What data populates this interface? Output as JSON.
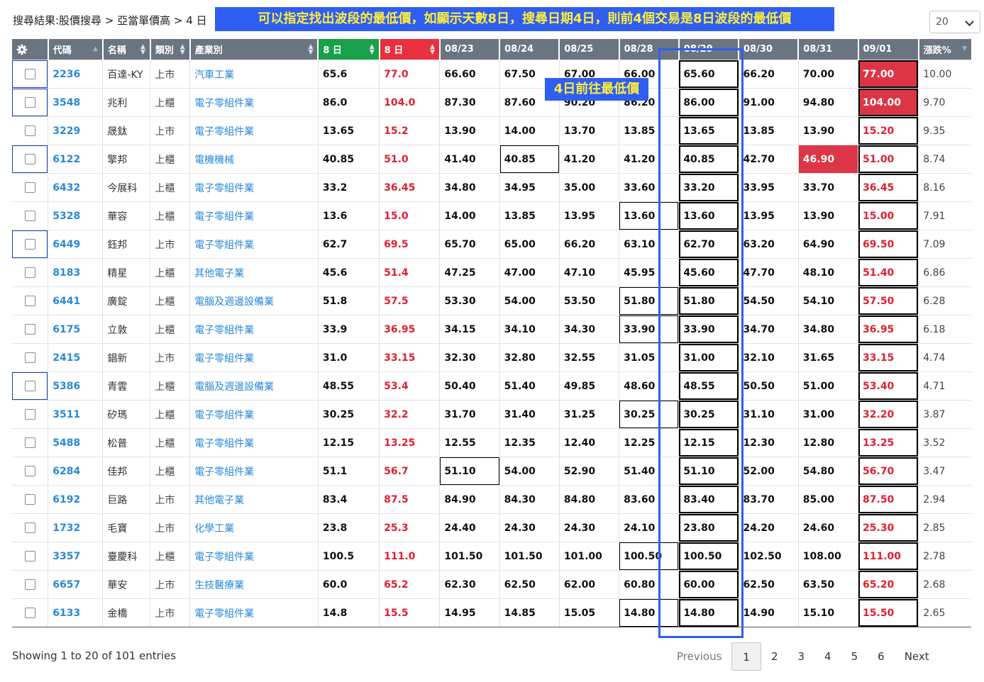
{
  "breadcrumb": "搜尋結果:股價搜尋 > 亞當單價高 > 4 日",
  "banner": "可以指定找出波段的最低價，如顯示天數8日，搜尋日期4日，則前4個交易是8日波段的最低價",
  "annotation_tag": "4日前往最低價",
  "page_size": "20",
  "headers": [
    "",
    "代碼",
    "名稱",
    "類別",
    "產業別",
    "8 日",
    "8 日",
    "08/23",
    "08/24",
    "08/25",
    "08/28",
    "08/29",
    "08/30",
    "08/31",
    "09/01",
    "漲跌%"
  ],
  "rows": [
    [
      "2236",
      "百達-KY",
      "上市",
      "汽車工業",
      "65.6",
      "77.0",
      "66.60",
      "67.50",
      "67.00",
      "66.00",
      "65.60",
      "66.20",
      "70.00",
      "77.00",
      "10.00"
    ],
    [
      "3548",
      "兆利",
      "上櫃",
      "電子零組件業",
      "86.0",
      "104.0",
      "87.30",
      "87.60",
      "90.20",
      "86.20",
      "86.00",
      "91.00",
      "94.80",
      "104.00",
      "9.70"
    ],
    [
      "3229",
      "晟鈦",
      "上市",
      "電子零組件業",
      "13.65",
      "15.2",
      "13.90",
      "14.00",
      "13.70",
      "13.85",
      "13.65",
      "13.85",
      "13.90",
      "15.20",
      "9.35"
    ],
    [
      "6122",
      "擎邦",
      "上櫃",
      "電機機械",
      "40.85",
      "51.0",
      "41.40",
      "40.85",
      "41.20",
      "41.20",
      "40.85",
      "42.70",
      "46.90",
      "51.00",
      "8.74"
    ],
    [
      "6432",
      "今展科",
      "上櫃",
      "電子零組件業",
      "33.2",
      "36.45",
      "34.80",
      "34.95",
      "35.00",
      "33.60",
      "33.20",
      "33.95",
      "33.70",
      "36.45",
      "8.16"
    ],
    [
      "5328",
      "華容",
      "上櫃",
      "電子零組件業",
      "13.6",
      "15.0",
      "14.00",
      "13.85",
      "13.95",
      "13.60",
      "13.60",
      "13.95",
      "13.90",
      "15.00",
      "7.91"
    ],
    [
      "6449",
      "鈺邦",
      "上市",
      "電子零組件業",
      "62.7",
      "69.5",
      "65.70",
      "65.00",
      "66.20",
      "63.10",
      "62.70",
      "63.20",
      "64.90",
      "69.50",
      "7.09"
    ],
    [
      "8183",
      "精星",
      "上櫃",
      "其他電子業",
      "45.6",
      "51.4",
      "47.25",
      "47.00",
      "47.10",
      "45.95",
      "45.60",
      "47.70",
      "48.10",
      "51.40",
      "6.86"
    ],
    [
      "6441",
      "廣錠",
      "上櫃",
      "電腦及週邊設備業",
      "51.8",
      "57.5",
      "53.30",
      "54.00",
      "53.50",
      "51.80",
      "51.80",
      "54.50",
      "54.10",
      "57.50",
      "6.28"
    ],
    [
      "6175",
      "立敦",
      "上櫃",
      "電子零組件業",
      "33.9",
      "36.95",
      "34.15",
      "34.10",
      "34.30",
      "33.90",
      "33.90",
      "34.70",
      "34.80",
      "36.95",
      "6.18"
    ],
    [
      "2415",
      "錩新",
      "上市",
      "電子零組件業",
      "31.0",
      "33.15",
      "32.30",
      "32.80",
      "32.55",
      "31.05",
      "31.00",
      "32.10",
      "31.65",
      "33.15",
      "4.74"
    ],
    [
      "5386",
      "青雲",
      "上櫃",
      "電腦及週邊設備業",
      "48.55",
      "53.4",
      "50.40",
      "51.40",
      "49.85",
      "48.60",
      "48.55",
      "50.50",
      "51.00",
      "53.40",
      "4.71"
    ],
    [
      "3511",
      "矽瑪",
      "上櫃",
      "電子零組件業",
      "30.25",
      "32.2",
      "31.70",
      "31.40",
      "31.25",
      "30.25",
      "30.25",
      "31.10",
      "31.00",
      "32.20",
      "3.87"
    ],
    [
      "5488",
      "松普",
      "上櫃",
      "電子零組件業",
      "12.15",
      "13.25",
      "12.55",
      "12.35",
      "12.40",
      "12.25",
      "12.15",
      "12.30",
      "12.80",
      "13.25",
      "3.52"
    ],
    [
      "6284",
      "佳邦",
      "上櫃",
      "電子零組件業",
      "51.1",
      "56.7",
      "51.10",
      "54.00",
      "52.90",
      "51.40",
      "51.10",
      "52.00",
      "54.80",
      "56.70",
      "3.47"
    ],
    [
      "6192",
      "巨路",
      "上市",
      "其他電子業",
      "83.4",
      "87.5",
      "84.90",
      "84.30",
      "84.80",
      "83.60",
      "83.40",
      "83.70",
      "85.00",
      "87.50",
      "2.94"
    ],
    [
      "1732",
      "毛寶",
      "上市",
      "化學工業",
      "23.8",
      "25.3",
      "24.40",
      "24.30",
      "24.30",
      "24.10",
      "23.80",
      "24.20",
      "24.60",
      "25.30",
      "2.85"
    ],
    [
      "3357",
      "臺慶科",
      "上櫃",
      "電子零組件業",
      "100.5",
      "111.0",
      "101.50",
      "101.50",
      "101.00",
      "100.50",
      "100.50",
      "102.50",
      "108.00",
      "111.00",
      "2.78"
    ],
    [
      "6657",
      "華安",
      "上市",
      "生技醫療業",
      "60.0",
      "65.2",
      "62.30",
      "62.50",
      "62.00",
      "60.80",
      "60.00",
      "62.50",
      "63.50",
      "65.20",
      "2.68"
    ],
    [
      "6133",
      "金橋",
      "上市",
      "電子零組件業",
      "14.8",
      "15.5",
      "14.95",
      "14.85",
      "15.05",
      "14.80",
      "14.80",
      "14.90",
      "15.10",
      "15.50",
      "2.65"
    ]
  ],
  "footer": {
    "info": "Showing 1 to 20 of 101 entries",
    "previous": "Previous",
    "pages": [
      "1",
      "2",
      "3",
      "4",
      "5",
      "6"
    ],
    "next": "Next"
  }
}
